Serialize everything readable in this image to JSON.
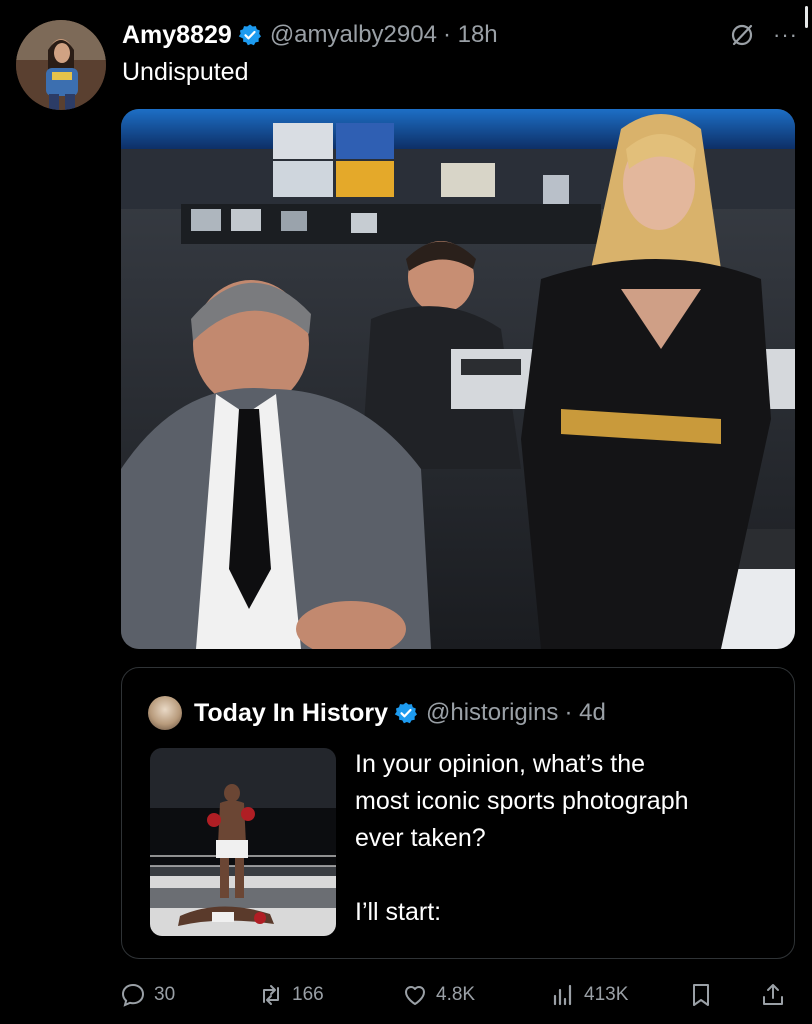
{
  "post": {
    "author_name": "Amy8829",
    "author_handle": "@amyalby2904",
    "time": "· 18h",
    "text": "Undisputed"
  },
  "quoted": {
    "author_name": "Today In History",
    "author_handle": "@historigins",
    "time": "· 4d",
    "text_lines": [
      "In your opinion, what’s the",
      "most iconic sports photograph",
      "ever taken?"
    ],
    "text_after": "I’ll start:"
  },
  "actions": {
    "replies": "30",
    "reposts": "166",
    "likes": "4.8K",
    "views": "413K"
  },
  "colors": {
    "background": "#000000",
    "verified": "#1d9bf0",
    "muted": "#9aa0a6"
  },
  "icons": [
    "verified-badge-icon",
    "grok-icon",
    "more-icon",
    "reply-icon",
    "repost-icon",
    "like-icon",
    "views-icon",
    "bookmark-icon",
    "share-icon"
  ]
}
